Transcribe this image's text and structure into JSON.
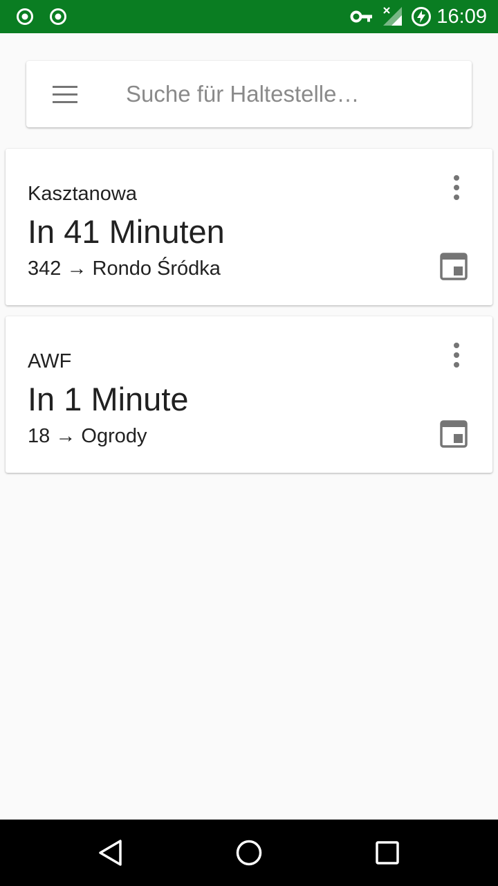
{
  "status_bar": {
    "time": "16:09",
    "icons": [
      "record-icon",
      "record-icon",
      "vpn-key-icon",
      "signal-no-data-icon",
      "battery-charging-icon"
    ]
  },
  "search": {
    "placeholder": "Suche für Haltestelle…",
    "value": "",
    "menu_icon": "menu-icon"
  },
  "departures": [
    {
      "stop": "Kasztanowa",
      "eta": "In 41 Minuten",
      "line": "342",
      "arrow": "→",
      "destination": "Rondo Śródka"
    },
    {
      "stop": "AWF",
      "eta": "In 1 Minute",
      "line": "18",
      "arrow": "→",
      "destination": "Ogrody"
    }
  ],
  "nav_bar": {
    "icons": [
      "back-icon",
      "home-icon",
      "recents-icon"
    ]
  },
  "colors": {
    "status_bar": "#0a7d22",
    "background": "#fafafa",
    "card": "#ffffff",
    "icon_gray": "#757575",
    "nav_bar": "#000000"
  }
}
